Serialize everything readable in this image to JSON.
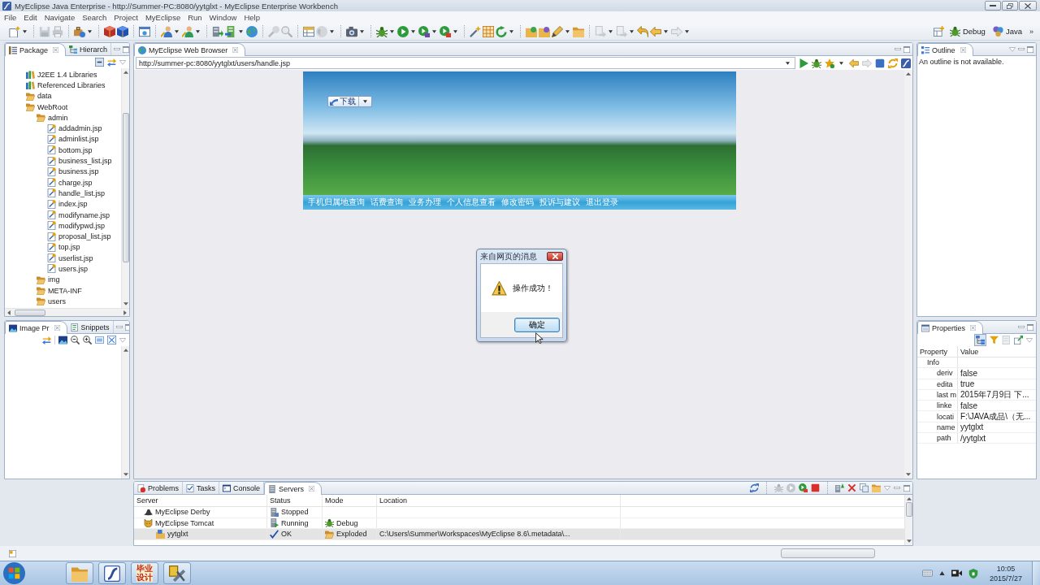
{
  "window": {
    "title": "MyEclipse Java Enterprise - http://Summer-PC:8080/yytglxt - MyEclipse Enterprise Workbench"
  },
  "menu": [
    "File",
    "Edit",
    "Navigate",
    "Search",
    "Project",
    "MyEclipse",
    "Run",
    "Window",
    "Help"
  ],
  "perspectives": {
    "buttons": [
      {
        "label": "Debug"
      },
      {
        "label": "Java"
      }
    ],
    "overflow": "»"
  },
  "package_explorer": {
    "tabs": [
      {
        "label": "Package",
        "selected": true
      },
      {
        "label": "Hierarch",
        "selected": false
      }
    ],
    "tree": [
      {
        "label": "J2EE 1.4 Libraries",
        "kind": "library"
      },
      {
        "label": "Referenced Libraries",
        "kind": "library"
      },
      {
        "label": "data",
        "kind": "folder"
      },
      {
        "label": "WebRoot",
        "kind": "folder",
        "children": [
          {
            "label": "admin",
            "kind": "folder",
            "children": [
              {
                "label": "addadmin.jsp",
                "kind": "jsp"
              },
              {
                "label": "adminlist.jsp",
                "kind": "jsp"
              },
              {
                "label": "bottom.jsp",
                "kind": "jsp"
              },
              {
                "label": "business_list.jsp",
                "kind": "jsp"
              },
              {
                "label": "business.jsp",
                "kind": "jsp"
              },
              {
                "label": "charge.jsp",
                "kind": "jsp"
              },
              {
                "label": "handle_list.jsp",
                "kind": "jsp"
              },
              {
                "label": "index.jsp",
                "kind": "jsp"
              },
              {
                "label": "modifyname.jsp",
                "kind": "jsp"
              },
              {
                "label": "modifypwd.jsp",
                "kind": "jsp"
              },
              {
                "label": "proposal_list.jsp",
                "kind": "jsp"
              },
              {
                "label": "top.jsp",
                "kind": "jsp"
              },
              {
                "label": "userlist.jsp",
                "kind": "jsp"
              },
              {
                "label": "users.jsp",
                "kind": "jsp"
              }
            ]
          },
          {
            "label": "img",
            "kind": "folder"
          },
          {
            "label": "META-INF",
            "kind": "folder"
          },
          {
            "label": "users",
            "kind": "folder"
          }
        ]
      }
    ]
  },
  "image_preview": {
    "tabs": [
      {
        "label": "Image Pr",
        "selected": true
      },
      {
        "label": "Snippets",
        "selected": false
      }
    ]
  },
  "editor": {
    "tabs": [
      {
        "label": "MyEclipse Web Browser",
        "selected": true
      }
    ],
    "url": "http://summer-pc:8080/yytglxt/users/handle.jsp",
    "page": {
      "download_button": "下载",
      "nav_links": [
        "手机归属地查询",
        "话费查询",
        "业务办理",
        "个人信息查看",
        "修改密码",
        "投诉与建议",
        "退出登录"
      ]
    },
    "dialog": {
      "title": "来自网页的消息",
      "message": "操作成功！",
      "button": "确定"
    }
  },
  "outline": {
    "tabs": [
      {
        "label": "Outline",
        "selected": true
      }
    ],
    "message": "An outline is not available."
  },
  "properties": {
    "tabs": [
      {
        "label": "Properties",
        "selected": true
      }
    ],
    "show_categories": true,
    "columns": [
      "Property",
      "Value"
    ],
    "rows": [
      {
        "name": "Info",
        "children": [
          {
            "name": "deriv",
            "value": "false"
          },
          {
            "name": "edita",
            "value": "true"
          },
          {
            "name": "last m",
            "value": "2015年7月9日 下..."
          },
          {
            "name": "linke",
            "value": "false"
          },
          {
            "name": "locati",
            "value": "F:\\JAVA成品\\（无..."
          },
          {
            "name": "name",
            "value": "yytglxt"
          },
          {
            "name": "path",
            "value": "/yytglxt"
          }
        ]
      }
    ]
  },
  "servers_panel": {
    "tabs": [
      {
        "label": "Problems",
        "selected": false
      },
      {
        "label": "Tasks",
        "selected": false
      },
      {
        "label": "Console",
        "selected": false
      },
      {
        "label": "Servers",
        "selected": true
      }
    ],
    "columns": [
      "Server",
      "Status",
      "Mode",
      "Location"
    ],
    "rows": [
      {
        "server": "MyEclipse Derby",
        "kind": "derby",
        "status": {
          "label": "Stopped",
          "kind": "stopped"
        },
        "selected": false
      },
      {
        "server": "MyEclipse Tomcat",
        "kind": "tomcat",
        "status": {
          "label": "Running",
          "kind": "running"
        },
        "mode": "Debug",
        "selected": false,
        "children": [
          {
            "server": "yytglxt",
            "kind": "module",
            "status": {
              "label": "OK",
              "kind": "ok"
            },
            "mode": "Exploded",
            "location": "C:\\Users\\Summer\\Workspaces\\MyEclipse 8.6\\.metadata\\...",
            "selected": true
          }
        ]
      }
    ]
  },
  "taskbar": {
    "pinned_label": "毕业设计",
    "time": "10:05",
    "date": "2015/7/27"
  }
}
